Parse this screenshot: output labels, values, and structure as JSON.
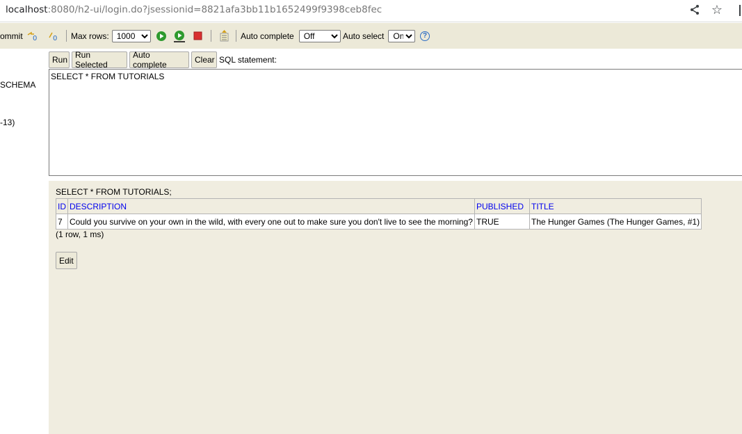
{
  "browser": {
    "url_host": "localhost",
    "url_rest": ":8080/h2-ui/login.do?jsessionid=8821afa3bb11b1652499f9398ceb8fec",
    "icons": [
      "share-icon",
      "star-icon"
    ]
  },
  "toolbar": {
    "commit_label": "ommit",
    "max_rows_label": "Max rows:",
    "max_rows_value": "1000",
    "auto_complete_label": "Auto complete",
    "auto_complete_value": "Off",
    "auto_select_label": "Auto select",
    "auto_select_value": "On",
    "help_glyph": "?",
    "icons": [
      "refresh-icon",
      "autocommit-icon",
      "run-icon",
      "run-selected-icon",
      "stop-icon",
      "history-icon",
      "help-icon"
    ],
    "colors": {
      "run_green": "#2e9a2e",
      "stop_red": "#d93030",
      "help_blue": "#2b6cc4"
    }
  },
  "tree": {
    "schema_label": "SCHEMA",
    "version_label": "-13)"
  },
  "query": {
    "run_label": "Run",
    "run_selected_label": "Run Selected",
    "auto_complete_label": "Auto complete",
    "clear_label": "Clear",
    "sql_statement_label": "SQL statement:",
    "sql_text": "SELECT * FROM TUTORIALS"
  },
  "result": {
    "sql_echo": "SELECT * FROM TUTORIALS;",
    "columns": [
      "ID",
      "DESCRIPTION",
      "PUBLISHED",
      "TITLE"
    ],
    "rows": [
      [
        "7",
        "Could you survive on your own in the wild, with every one out to make sure you don't live to see the morning?",
        "TRUE",
        "The Hunger Games (The Hunger Games, #1)"
      ]
    ],
    "row_info": "(1 row, 1 ms)",
    "edit_label": "Edit"
  }
}
